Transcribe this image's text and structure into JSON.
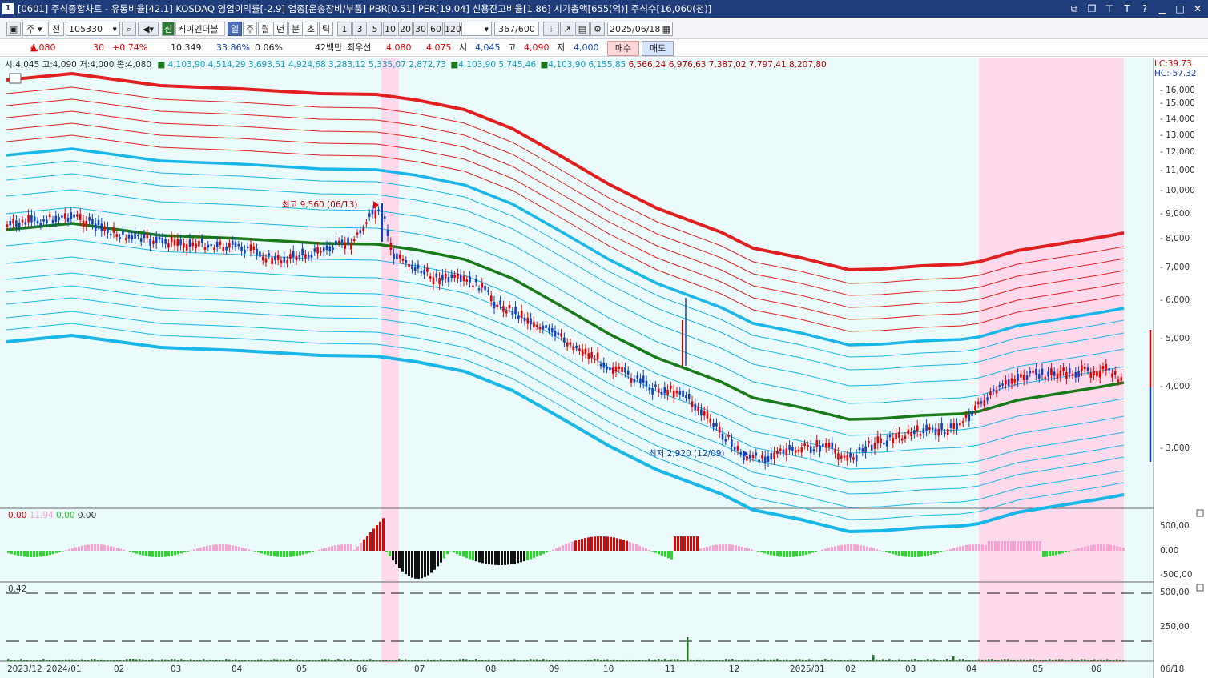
{
  "window": {
    "num": "1",
    "title": "[0601] 주식종합차트 - 유통비율[42.1] KOSDAQ 영업이익률[-2.9] 업종[운송장비/부품] PBR[0.51] PER[19.04] 신용잔고비율[1.86] 시가총액[655(억)] 주식수[16,060(천)]"
  },
  "toolbar": {
    "period_type": "주",
    "mode": "전",
    "code": "105330",
    "stock_name": "케이엔더블",
    "periods": [
      "일",
      "주",
      "월",
      "년",
      "분",
      "초",
      "틱"
    ],
    "ticks": [
      "1",
      "3",
      "5",
      "10",
      "20",
      "30",
      "60",
      "120"
    ],
    "count": "367",
    "count_max": "/600",
    "date": "2025/06/18",
    "buy_label": "매수",
    "sell_label": "매도",
    "shin": "신"
  },
  "quote": {
    "price": "4,080",
    "change": "30",
    "change_pct": "+0.74%",
    "volume": "10,349",
    "vol_ratio": "33.86%",
    "turnover": "0.06%",
    "amount": "42백만",
    "best_label": "최우선",
    "ask": "4,080",
    "bid": "4,075",
    "open_label": "시",
    "open": "4,045",
    "high_label": "고",
    "high": "4,090",
    "low_label": "저",
    "low": "4,000"
  },
  "legend": {
    "ohlc": "시:4,045 고:4,090 저:4,000 종:4,080",
    "group1": "4,103,90 4,514,29 3,693,51 4,924,68 3,283,12 5,335,07 2,872,73",
    "group2": "4,103,90 5,745,46",
    "group3": "4,103,90 6,155,85",
    "group4": "6,566,24 6,976,63 7,387,02 7,797,41 8,207,80",
    "lc": "LC:39.73",
    "hc": "HC:-57.32"
  },
  "annotations": {
    "high": "최고 9,560 (06/13)",
    "low": "최저 2,920 (12/09)"
  },
  "yaxis_main": [
    "16,000",
    "15,000",
    "14,000",
    "13,000",
    "12,000",
    "11,000",
    "10,000",
    "9,000",
    "8,000",
    "7,000",
    "6,000",
    "5,000",
    "4,000",
    "3,000"
  ],
  "panel2": {
    "legend_a": "0.00",
    "legend_b": "11.94",
    "legend_c": "0.00",
    "legend_d": "0.00",
    "yaxis": [
      "500,00",
      "0,00",
      "-500,00"
    ]
  },
  "panel3": {
    "legend": "0.42",
    "yaxis": [
      "500,00",
      "250,00"
    ]
  },
  "xaxis": [
    "2023/12",
    "2024/01",
    "02",
    "03",
    "04",
    "05",
    "06",
    "07",
    "08",
    "09",
    "10",
    "11",
    "12",
    "2025/01",
    "02",
    "03",
    "04",
    "05",
    "06",
    "06/18"
  ],
  "colors": {
    "up": "#e60000",
    "down": "#1040c0",
    "mid": "#1a7a1a",
    "band_outer": "#19b6e8",
    "band_upper": "#e02020",
    "shade": "#ffd9ec"
  }
}
